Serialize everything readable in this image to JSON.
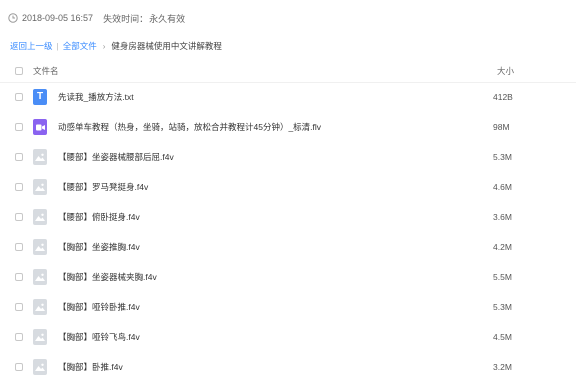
{
  "share": {
    "created_time": "2018-09-05 16:57",
    "expire_label": "失效时间：",
    "expire_value": "永久有效"
  },
  "breadcrumb": {
    "back_label": "返回上一级",
    "separator": "|",
    "root_label": "全部文件",
    "arrow": "›",
    "current_label": "健身房器械使用中文讲解教程"
  },
  "table": {
    "header_name": "文件名",
    "header_size": "大小",
    "rows": [
      {
        "name": "先读我_播放方法.txt",
        "size": "412B",
        "icon": "txt-file-icon"
      },
      {
        "name": "动感单车教程（热身，坐骑，站骑，放松合并教程计45分钟）_标清.flv",
        "size": "98M",
        "icon": "video-file-icon"
      },
      {
        "name": "【腰部】坐姿器械腰部后屈.f4v",
        "size": "5.3M",
        "icon": "f4v-file-icon"
      },
      {
        "name": "【腰部】罗马凳挺身.f4v",
        "size": "4.6M",
        "icon": "f4v-file-icon"
      },
      {
        "name": "【腰部】俯卧挺身.f4v",
        "size": "3.6M",
        "icon": "f4v-file-icon"
      },
      {
        "name": "【胸部】坐姿推胸.f4v",
        "size": "4.2M",
        "icon": "f4v-file-icon"
      },
      {
        "name": "【胸部】坐姿器械夹胸.f4v",
        "size": "5.5M",
        "icon": "f4v-file-icon"
      },
      {
        "name": "【胸部】哑铃卧推.f4v",
        "size": "5.3M",
        "icon": "f4v-file-icon"
      },
      {
        "name": "【胸部】哑铃飞鸟.f4v",
        "size": "4.5M",
        "icon": "f4v-file-icon"
      },
      {
        "name": "【胸部】卧推.f4v",
        "size": "3.2M",
        "icon": "f4v-file-icon"
      }
    ]
  },
  "colors": {
    "link": "#3b8cff",
    "txt_icon": "#4a8df6",
    "video_icon": "#8a63f0",
    "f4v_icon": "#d7dbe0"
  }
}
